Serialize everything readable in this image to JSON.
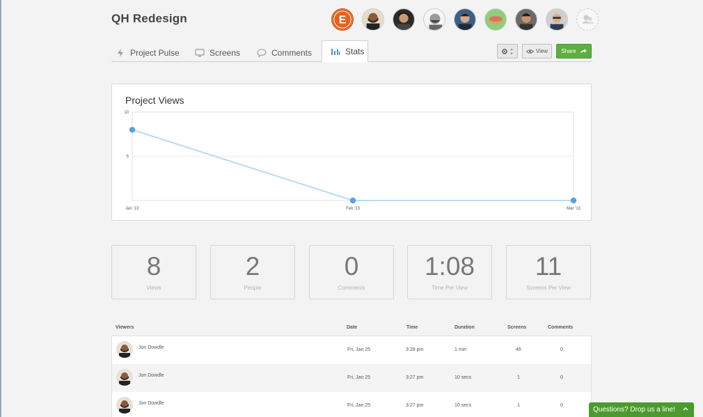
{
  "project": {
    "title": "QH Redesign"
  },
  "avatars": [
    {
      "name": "avatar-logo",
      "letter": "E",
      "color": "#e8621e"
    },
    {
      "name": "avatar-user-1"
    },
    {
      "name": "avatar-user-2"
    },
    {
      "name": "avatar-user-3"
    },
    {
      "name": "avatar-user-4"
    },
    {
      "name": "avatar-user-5"
    },
    {
      "name": "avatar-user-6"
    },
    {
      "name": "avatar-user-7"
    },
    {
      "name": "avatar-add-user"
    }
  ],
  "tabs": [
    {
      "label": "Project Pulse",
      "icon": "bolt-icon"
    },
    {
      "label": "Screens",
      "icon": "monitor-icon"
    },
    {
      "label": "Comments",
      "icon": "speech-bubble-icon"
    },
    {
      "label": "Stats",
      "icon": "bar-chart-icon",
      "active": true
    }
  ],
  "toolbar": {
    "view_label": "View",
    "share_label": "Share"
  },
  "chart": {
    "title": "Project Views"
  },
  "chart_data": {
    "type": "line",
    "title": "Project Views",
    "categories": [
      "Jan '13",
      "Feb '13",
      "Mar '13"
    ],
    "values": [
      8,
      0,
      0
    ],
    "ylim": [
      0,
      10
    ],
    "yticks": [
      "10",
      "5"
    ],
    "grid": true,
    "line_color": "#b8dcf2",
    "point_color": "#5aa0e0"
  },
  "stats": [
    {
      "value": "8",
      "label": "Views"
    },
    {
      "value": "2",
      "label": "People"
    },
    {
      "value": "0",
      "label": "Comments"
    },
    {
      "value": "1:08",
      "label": "Time Per View"
    },
    {
      "value": "11",
      "label": "Screens Per View"
    }
  ],
  "table": {
    "headers": [
      "Viewers",
      "Date",
      "Time",
      "Duration",
      "Screens",
      "Comments"
    ],
    "rows": [
      {
        "viewer": "Jon Dowdle",
        "date": "Fri, Jan 25",
        "time": "3:28 pm",
        "duration": "1 min",
        "screens": "46",
        "comments": "0"
      },
      {
        "viewer": "Jon Dowdle",
        "date": "Fri, Jan 25",
        "time": "3:27 pm",
        "duration": "10 secs",
        "screens": "1",
        "comments": "0"
      },
      {
        "viewer": "Jon Dowdle",
        "date": "Fri, Jan 25",
        "time": "3:27 pm",
        "duration": "10 secs",
        "screens": "1",
        "comments": "0"
      }
    ]
  },
  "chat": {
    "label": "Questions? Drop us a line!"
  },
  "colors": {
    "accent": "#5fae3f",
    "chat": "#4c9a2e",
    "brand_logo": "#e8621e"
  }
}
